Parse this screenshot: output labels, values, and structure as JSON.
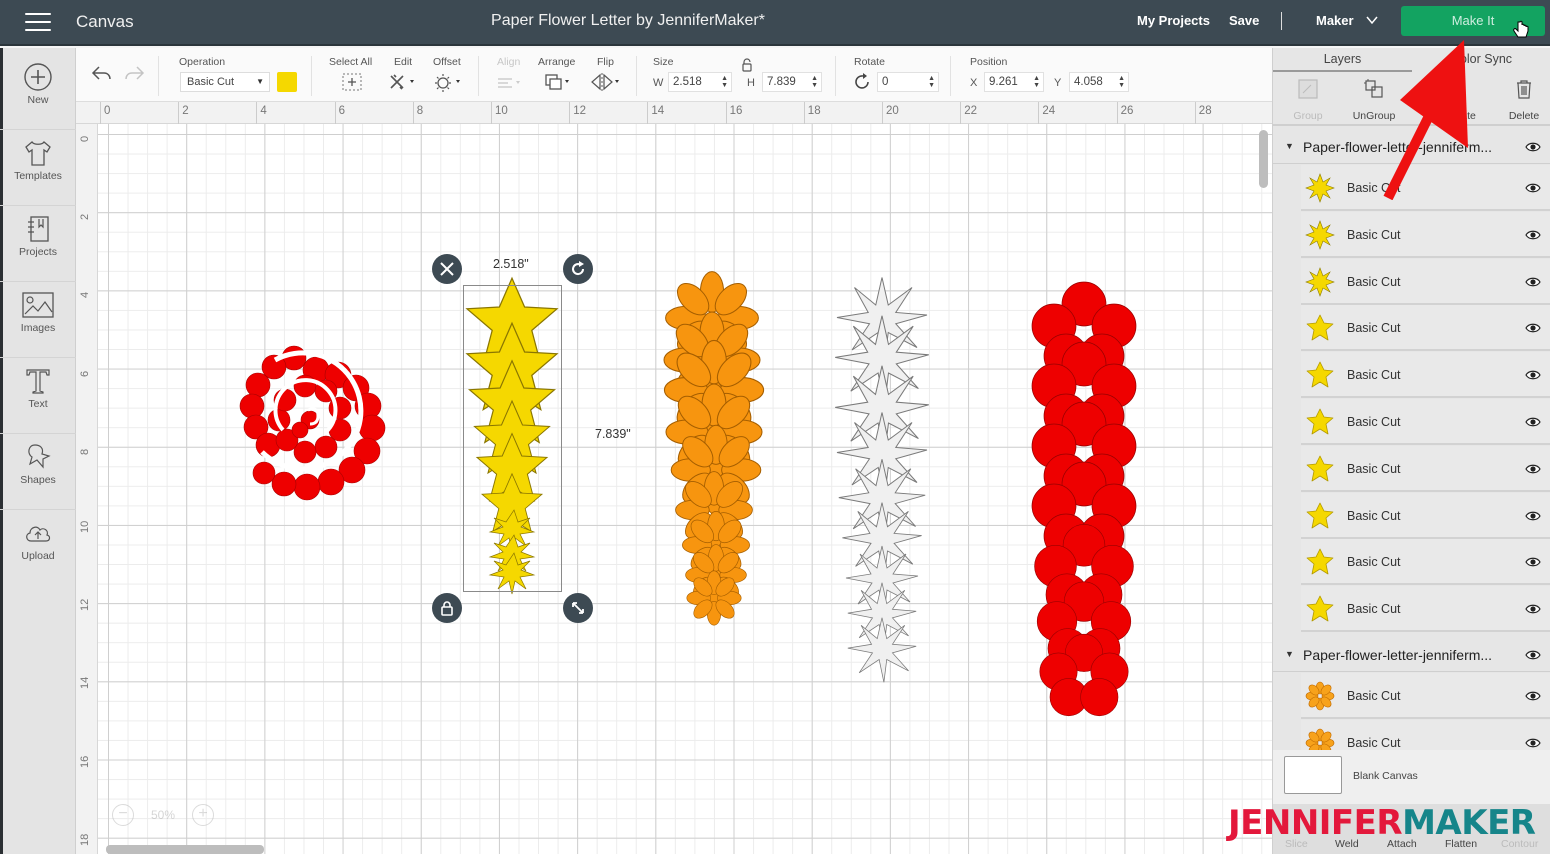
{
  "header": {
    "app_title": "Canvas",
    "document_title": "Paper Flower Letter by JenniferMaker*",
    "my_projects": "My Projects",
    "save": "Save",
    "machine": "Maker",
    "make_it": "Make It"
  },
  "sidebar": {
    "items": [
      {
        "label": "New",
        "icon": "plus-circle-icon"
      },
      {
        "label": "Templates",
        "icon": "tshirt-icon"
      },
      {
        "label": "Projects",
        "icon": "notebook-icon"
      },
      {
        "label": "Images",
        "icon": "image-icon"
      },
      {
        "label": "Text",
        "icon": "text-icon"
      },
      {
        "label": "Shapes",
        "icon": "shapes-icon"
      },
      {
        "label": "Upload",
        "icon": "cloud-upload-icon"
      }
    ]
  },
  "toolbar": {
    "operation_label": "Operation",
    "operation_value": "Basic Cut",
    "operation_color": "#f5d800",
    "select_all": "Select All",
    "edit": "Edit",
    "offset": "Offset",
    "align": "Align",
    "arrange": "Arrange",
    "flip": "Flip",
    "size_label": "Size",
    "w_label": "W",
    "w_value": "2.518",
    "h_label": "H",
    "h_value": "7.839",
    "rotate_label": "Rotate",
    "rotate_value": "0",
    "position_label": "Position",
    "x_label": "X",
    "x_value": "9.261",
    "y_label": "Y",
    "y_value": "4.058"
  },
  "rulers": {
    "top": [
      "0",
      "2",
      "4",
      "6",
      "8",
      "10",
      "12",
      "14",
      "16",
      "18",
      "20",
      "22",
      "24",
      "26",
      "28"
    ],
    "left": [
      "0",
      "2",
      "4",
      "6",
      "8",
      "10",
      "12",
      "14",
      "16",
      "18"
    ]
  },
  "canvas": {
    "selection_width": "2.518\"",
    "selection_height": "7.839\"",
    "zoom": "50%"
  },
  "layers_panel": {
    "tabs": [
      "Layers",
      "Color Sync"
    ],
    "actions": [
      {
        "label": "Group",
        "enabled": false
      },
      {
        "label": "UnGroup",
        "enabled": true
      },
      {
        "label": "Duplicate",
        "enabled": true
      },
      {
        "label": "Delete",
        "enabled": true
      }
    ],
    "groups": [
      {
        "name": "Paper-flower-letter-jenniferm...",
        "layers": [
          {
            "name": "Basic Cut",
            "shape": "burst",
            "color": "#f5d800"
          },
          {
            "name": "Basic Cut",
            "shape": "burst",
            "color": "#f5d800"
          },
          {
            "name": "Basic Cut",
            "shape": "burst",
            "color": "#f5d800"
          },
          {
            "name": "Basic Cut",
            "shape": "star",
            "color": "#f5d800"
          },
          {
            "name": "Basic Cut",
            "shape": "star",
            "color": "#f5d800"
          },
          {
            "name": "Basic Cut",
            "shape": "star",
            "color": "#f5d800"
          },
          {
            "name": "Basic Cut",
            "shape": "star",
            "color": "#f5d800"
          },
          {
            "name": "Basic Cut",
            "shape": "star",
            "color": "#f5d800"
          },
          {
            "name": "Basic Cut",
            "shape": "star",
            "color": "#f5d800"
          },
          {
            "name": "Basic Cut",
            "shape": "star",
            "color": "#f5d800"
          }
        ]
      },
      {
        "name": "Paper-flower-letter-jenniferm...",
        "layers": [
          {
            "name": "Basic Cut",
            "shape": "flower",
            "color": "#f7a21b"
          },
          {
            "name": "Basic Cut",
            "shape": "flower",
            "color": "#f7a21b"
          }
        ]
      }
    ],
    "blank_canvas": "Blank Canvas",
    "bottom_actions": [
      {
        "label": "Slice",
        "enabled": false
      },
      {
        "label": "Weld",
        "enabled": true
      },
      {
        "label": "Attach",
        "enabled": true
      },
      {
        "label": "Flatten",
        "enabled": true
      },
      {
        "label": "Contour",
        "enabled": false
      }
    ]
  },
  "watermark": {
    "part1": "JENNIFER",
    "part2": "MAKER"
  },
  "colors": {
    "header_bg": "#3d4a53",
    "make_it_green": "#13a361",
    "red": "#ee0000",
    "yellow": "#f5d800",
    "orange": "#f7950f",
    "gray_outline": "#eeeeee"
  }
}
